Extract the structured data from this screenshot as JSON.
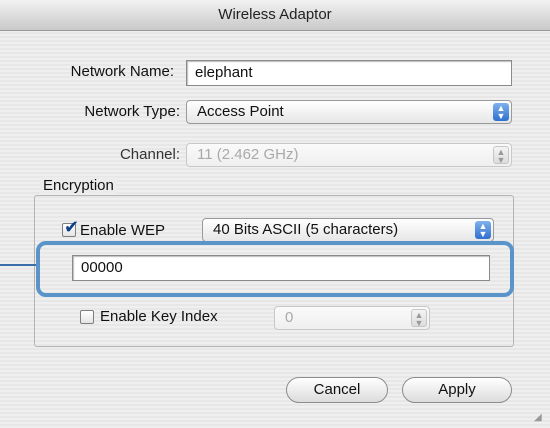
{
  "window": {
    "title": "Wireless Adaptor"
  },
  "form": {
    "network_name": {
      "label": "Network Name:",
      "value": "elephant"
    },
    "network_type": {
      "label": "Network Type:",
      "value": "Access Point"
    },
    "channel": {
      "label": "Channel:",
      "value": "11 (2.462 GHz)"
    }
  },
  "encryption": {
    "group_label": "Encryption",
    "enable_wep": {
      "label": "Enable WEP",
      "checked": true
    },
    "wep_mode": "40 Bits ASCII (5 characters)",
    "key_value": "00000",
    "enable_key_index": {
      "label": "Enable Key Index",
      "checked": false
    },
    "key_index_value": "0"
  },
  "buttons": {
    "cancel": "Cancel",
    "apply": "Apply"
  },
  "colors": {
    "highlight": "#5b94c9",
    "popup_arrow": "#2f6fd0"
  }
}
